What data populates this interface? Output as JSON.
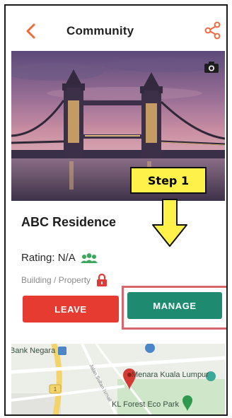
{
  "header": {
    "title": "Community",
    "back_icon": "chevron-left-icon",
    "share_icon": "share-icon"
  },
  "hero": {
    "camera_icon": "camera-icon"
  },
  "callout": {
    "step_label": "Step 1"
  },
  "community": {
    "name": "ABC Residence",
    "rating_label": "Rating: N/A",
    "type_label": "Building / Property"
  },
  "actions": {
    "leave_label": "LEAVE",
    "manage_label": "MANAGE"
  },
  "map": {
    "labels": {
      "bank": "Bank Negara",
      "tower": "Menara Kuala Lumpur",
      "park": "KL Forest Eco Park",
      "street": "Jalan Sultan Ismail"
    }
  },
  "colors": {
    "accent": "#ef6a3a",
    "leave": "#e53b30",
    "manage": "#1e8a6f",
    "highlight": "#d7666d",
    "callout": "#fdf14a"
  }
}
